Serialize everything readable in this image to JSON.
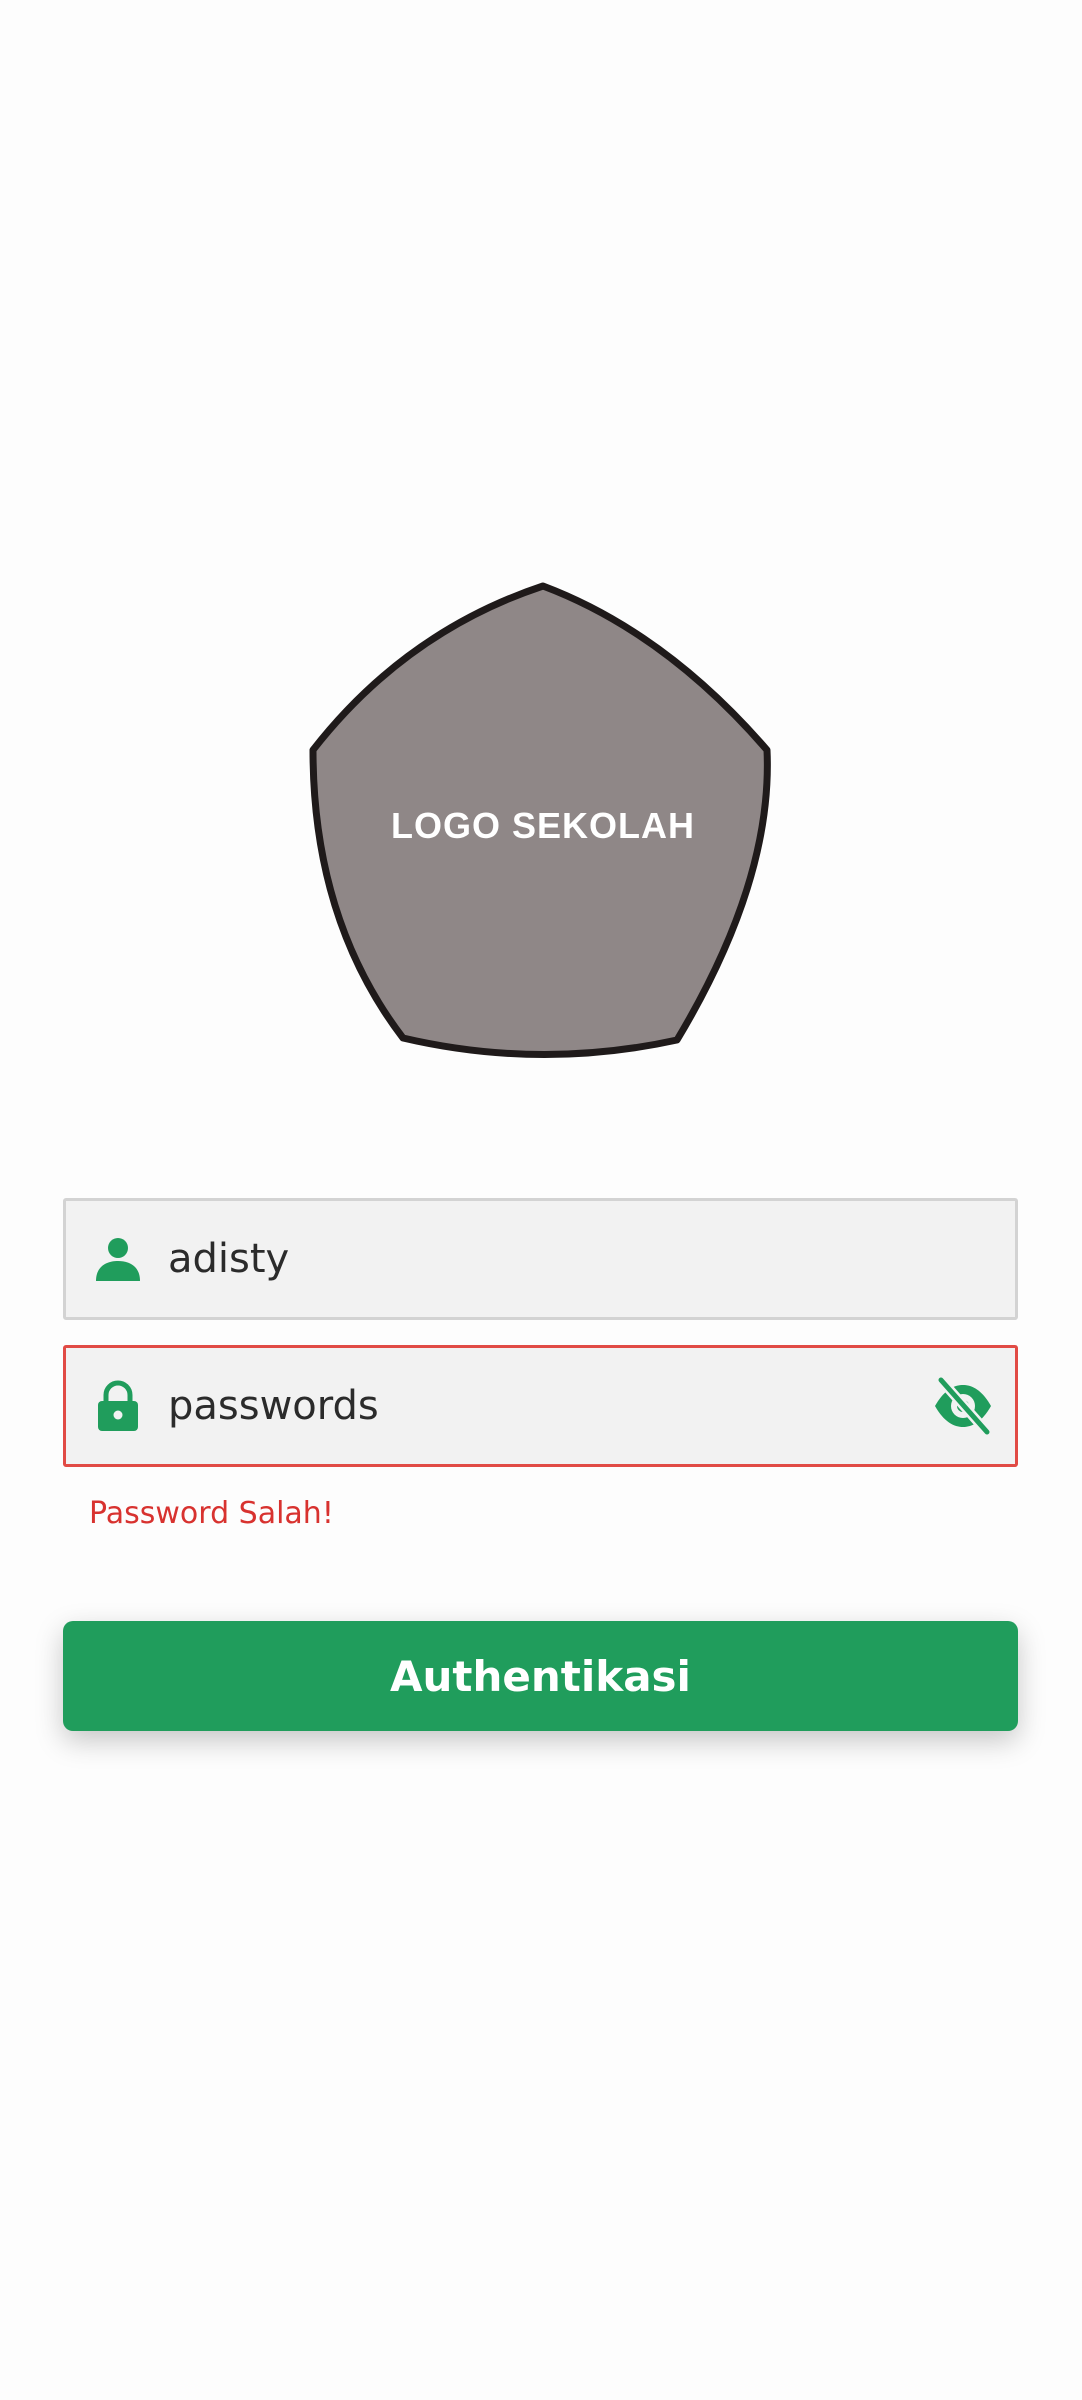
{
  "logo": {
    "text": "LOGO SEKOLAH",
    "fill_color": "#8f8787",
    "outline_color": "#1f1a1a"
  },
  "form": {
    "username": {
      "value": "adisty",
      "icon": "person-icon"
    },
    "password": {
      "value": "passwords",
      "icon": "lock-icon",
      "toggle_icon": "eye-off-icon",
      "error": "Password Salah!"
    },
    "submit_label": "Authentikasi"
  },
  "colors": {
    "accent": "#209d5c",
    "error": "#d8322f",
    "field_background": "#f2f2f2"
  }
}
